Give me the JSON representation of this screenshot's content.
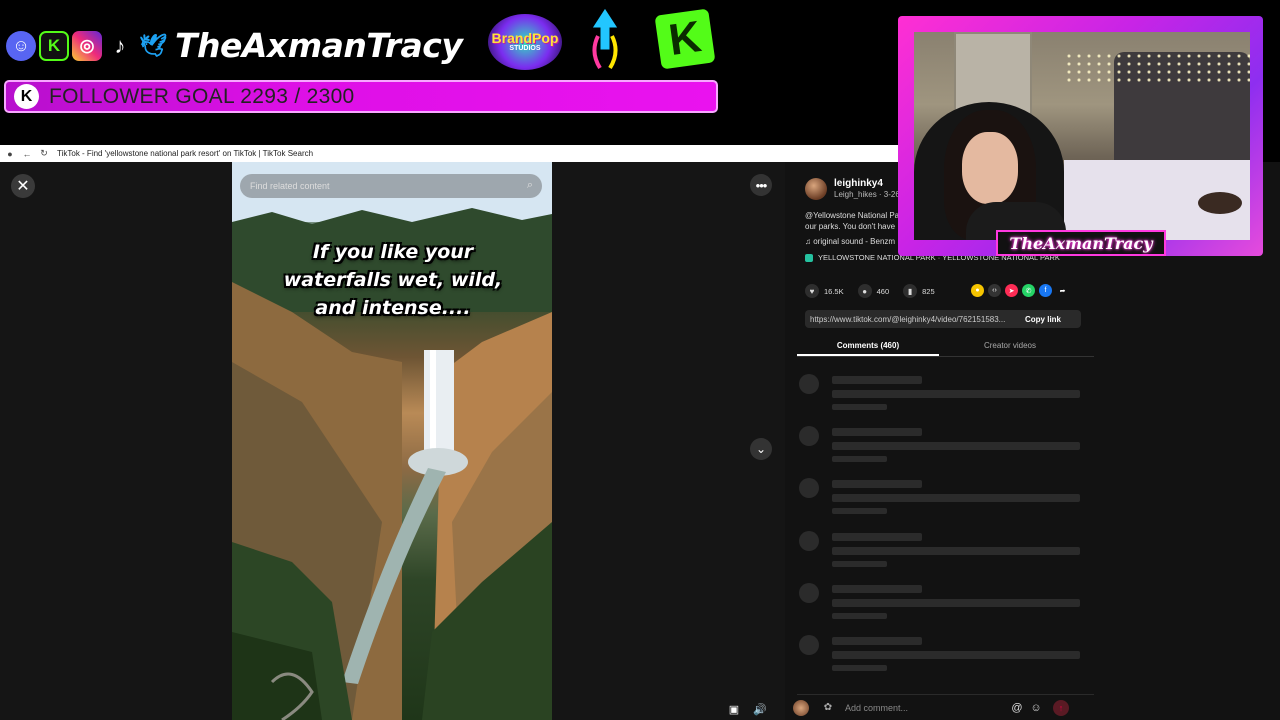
{
  "overlay": {
    "social_icons": [
      "discord-icon",
      "kick-icon",
      "instagram-icon",
      "tiktok-icon",
      "twitter-icon"
    ],
    "handle": "TheAxmanTracy",
    "brandpop": {
      "title": "BrandPop",
      "subtitle": "STUDIOS"
    },
    "kick_letter": "K",
    "follower_goal": {
      "label": "FOLLOWER GOAL 2293 / 2300",
      "current": 2293,
      "target": 2300
    },
    "cam_name": "TheAxmanTracy"
  },
  "browser": {
    "title": "TikTok - Find 'yellowstone national park resort' on TikTok | TikTok Search"
  },
  "tiktok": {
    "search_placeholder": "Find related content",
    "caption": "If you like your waterfalls wet, wild, and intense....",
    "author": {
      "username": "leighinky4",
      "nickname": "Leigh_hikes · 3-26"
    },
    "description_line1": "@Yellowstone National Pa",
    "description_line2": "our parks. You don't have",
    "sound": "original sound - Benzm",
    "location": "YELLOWSTONE NATIONAL PARK · YELLOWSTONE NATIONAL PARK",
    "stats": {
      "likes": "16.5K",
      "comments": "460",
      "saves": "825"
    },
    "link_url": "https://www.tiktok.com/@leighinky4/video/762151583...",
    "copy_link": "Copy link",
    "tabs": [
      "Comments (460)",
      "Creator videos"
    ],
    "comment_placeholder": "Add comment..."
  },
  "colors": {
    "goal_bar": "#dd10e6",
    "cam_frame": "#c824e6",
    "kick_green": "#53fc18",
    "tiktok_bg": "#121212"
  }
}
